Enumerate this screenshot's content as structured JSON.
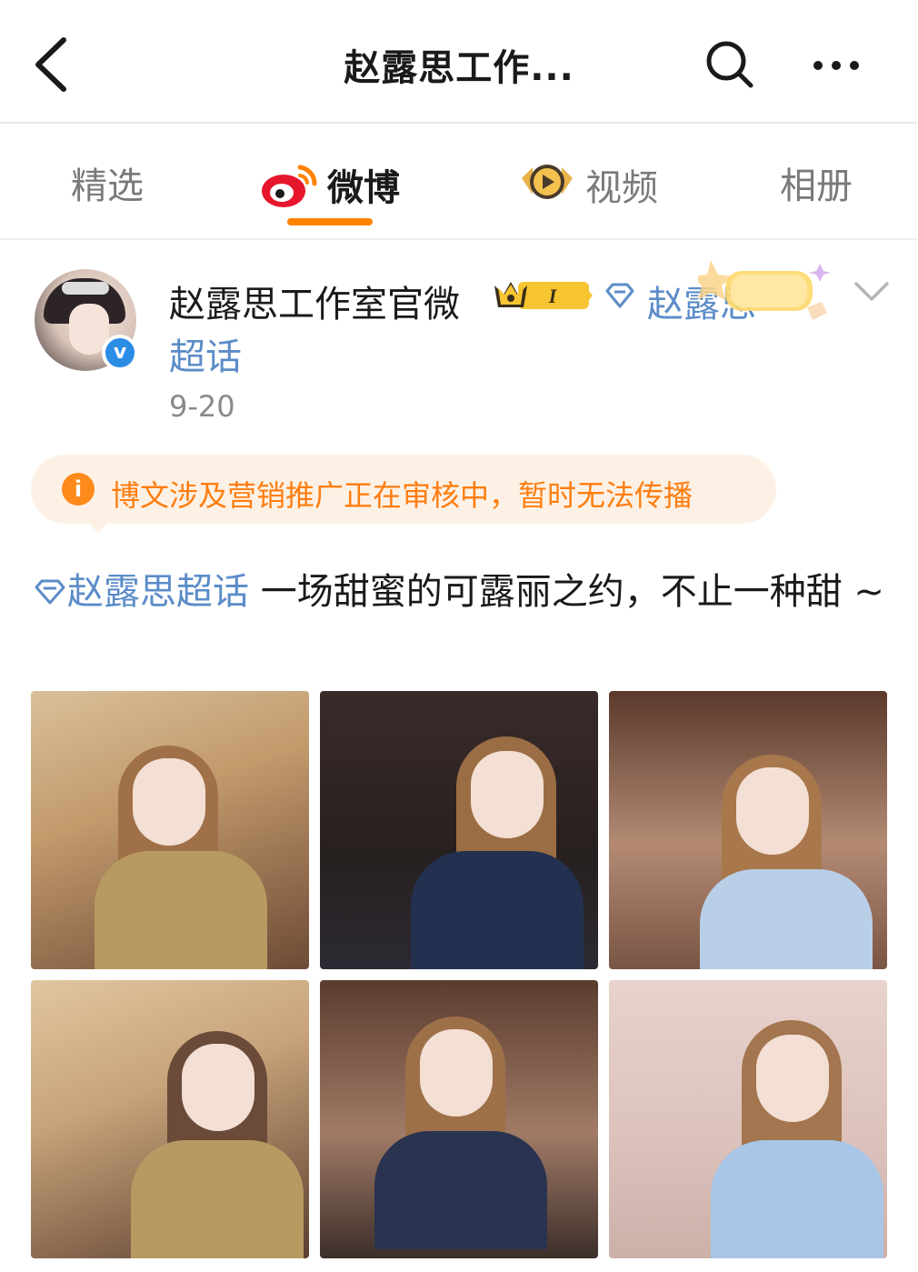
{
  "header": {
    "title": "赵露思工作..."
  },
  "tabs": [
    {
      "label": "精选"
    },
    {
      "label": "微博"
    },
    {
      "label": "视频"
    },
    {
      "label": "相册"
    }
  ],
  "post": {
    "author": "赵露思工作室官微",
    "author_badge_text": "I",
    "verified_mark": "v",
    "super_topic_line1": "赵露思",
    "super_topic_line2": "超话",
    "date": "9-20",
    "notice_icon": "i",
    "notice": "博文涉及营销推广正在审核中，暂时无法传播",
    "topic_tag": "赵露思超话",
    "body": " 一场甜蜜的可露丽之约，不止一种甜 ~",
    "image_count": 6
  },
  "colors": {
    "accent": "#ff8200",
    "link": "#5b8cc8",
    "notice_bg": "#fdf1e5",
    "notice_text": "#ff7d0f",
    "verified": "#2b8ce6"
  }
}
